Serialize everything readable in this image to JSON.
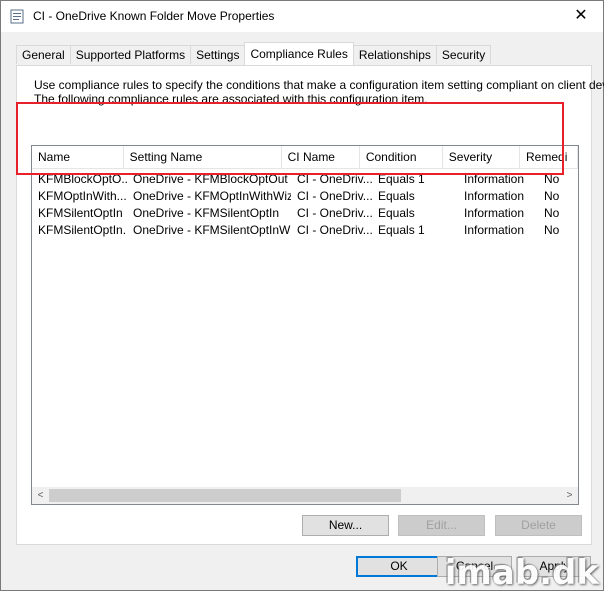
{
  "window": {
    "title": "CI - OneDrive Known Folder Move Properties",
    "close_glyph": "✕"
  },
  "tabs": [
    {
      "label": "General"
    },
    {
      "label": "Supported Platforms"
    },
    {
      "label": "Settings"
    },
    {
      "label": "Compliance Rules",
      "active": true
    },
    {
      "label": "Relationships"
    },
    {
      "label": "Security"
    }
  ],
  "panel": {
    "description_line1": "Use compliance rules to specify the conditions that make a configuration item setting compliant on client devices.",
    "description_line2": "The following compliance rules are associated with this configuration item."
  },
  "table": {
    "columns": [
      "Name",
      "Setting Name",
      "CI Name",
      "Condition",
      "Severity",
      "Remedi"
    ],
    "rows": [
      [
        "KFMBlockOptO...",
        "OneDrive - KFMBlockOptOut",
        "CI - OneDriv...",
        "Equals 1",
        "Information",
        "No"
      ],
      [
        "KFMOptInWith...",
        "OneDrive - KFMOptInWithWiz",
        "CI - OneDriv...",
        "Equals",
        "Information",
        "No"
      ],
      [
        "KFMSilentOptIn ...",
        "OneDrive - KFMSilentOptIn",
        "CI - OneDriv...",
        "Equals",
        "Information",
        "No"
      ],
      [
        "KFMSilentOptIn...",
        "OneDrive - KFMSilentOptInWi...",
        "CI - OneDriv...",
        "Equals 1",
        "Information",
        "No"
      ]
    ]
  },
  "scrollbar": {
    "left_glyph": "<",
    "right_glyph": ">"
  },
  "actions": {
    "new_label": "New...",
    "edit_label": "Edit...",
    "delete_label": "Delete"
  },
  "footer": {
    "ok_label": "OK",
    "cancel_label": "Cancel",
    "apply_label": "Apply"
  },
  "watermark": "imab.dk",
  "colors": {
    "highlight_border": "#e8202a",
    "default_button_border": "#0078d7"
  }
}
